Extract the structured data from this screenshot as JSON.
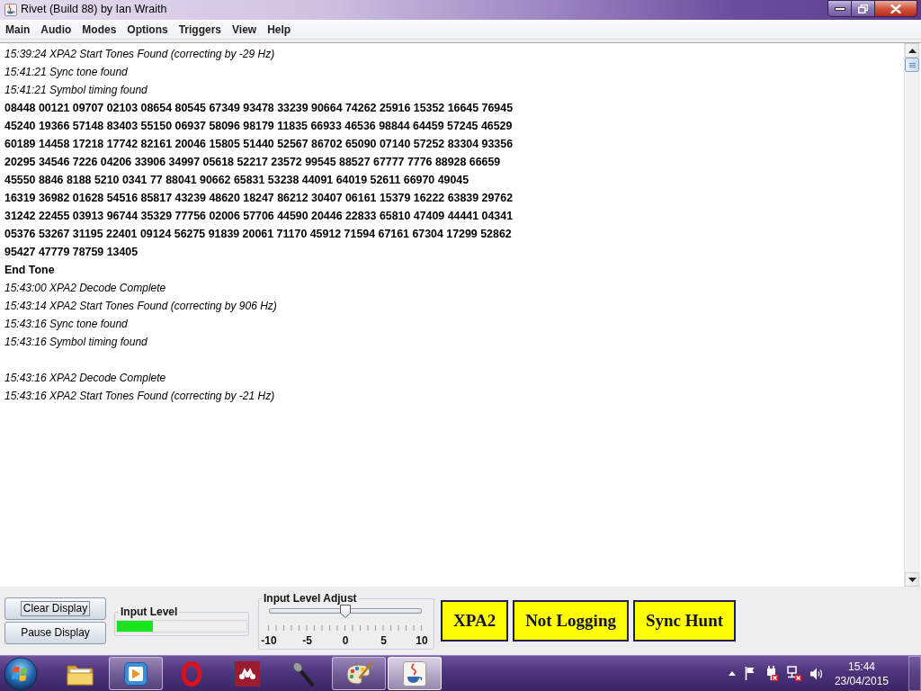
{
  "window": {
    "title": "Rivet (Build 88) by Ian Wraith"
  },
  "menu": [
    "Main",
    "Audio",
    "Modes",
    "Options",
    "Triggers",
    "View",
    "Help"
  ],
  "log": [
    {
      "kind": "status",
      "text": "15:39:24 XPA2 Start Tones Found (correcting by -29 Hz)"
    },
    {
      "kind": "status",
      "text": "15:41:21 Sync tone found"
    },
    {
      "kind": "status",
      "text": "15:41:21 Symbol timing found"
    },
    {
      "kind": "data",
      "text": "08448 00121 09707 02103 08654 80545 67349 93478 33239 90664 74262 25916 15352 16645 76945"
    },
    {
      "kind": "data",
      "text": "45240 19366 57148 83403 55150 06937 58096 98179 11835 66933 46536 98844 64459 57245 46529"
    },
    {
      "kind": "data",
      "text": "60189 14458 17218 17742 82161 20046 15805 51440 52567 86702 65090 07140 57252 83304 93356"
    },
    {
      "kind": "data",
      "text": "20295 34546 7226 04206 33906 34997 05618 52217 23572 99545 88527 67777 7776 88928 66659"
    },
    {
      "kind": "data",
      "text": "45550 8846 8188 5210 0341 77 88041 90662 65831 53238 44091 64019 52611 66970 49045"
    },
    {
      "kind": "data",
      "text": "16319 36982 01628 54516 85817 43239 48620 18247 86212 30407 06161 15379 16222 63839 29762"
    },
    {
      "kind": "data",
      "text": "31242 22455 03913 96744 35329 77756 02006 57706 44590 20446 22833 65810 47409 44441 04341"
    },
    {
      "kind": "data",
      "text": "05376 53267 31195 22401 09124 56275 91839 20061 71170 45912 71594 67161 67304 17299 52862"
    },
    {
      "kind": "data",
      "text": "95427 47779 78759 13405"
    },
    {
      "kind": "event",
      "text": "End Tone"
    },
    {
      "kind": "status",
      "text": "15:43:00 XPA2 Decode Complete"
    },
    {
      "kind": "status",
      "text": "15:43:14 XPA2 Start Tones Found (correcting by 906 Hz)"
    },
    {
      "kind": "status",
      "text": "15:43:16 Sync tone found"
    },
    {
      "kind": "status",
      "text": "15:43:16 Symbol timing found"
    },
    {
      "kind": "gap"
    },
    {
      "kind": "status",
      "text": "15:43:16 XPA2 Decode Complete"
    },
    {
      "kind": "status",
      "text": "15:43:16 XPA2 Start Tones Found (correcting by -21 Hz)"
    }
  ],
  "controls": {
    "buttons": [
      {
        "label": "Clear Display",
        "focused": true
      },
      {
        "label": "Pause Display",
        "focused": false
      }
    ],
    "input_level": {
      "title": "Input Level",
      "level": 0.28
    },
    "input_level_adjust": {
      "title": "Input Level Adjust",
      "level": 0.5,
      "tick_labels": [
        "-10",
        "-5",
        "0",
        "5",
        "10"
      ]
    },
    "indicators": [
      "XPA2",
      "Not Logging",
      "Sync Hunt"
    ]
  },
  "taskbar": {
    "apps": [
      {
        "running": false,
        "selected": false
      },
      {
        "running": true,
        "selected": false
      },
      {
        "running": false,
        "selected": false
      },
      {
        "running": false,
        "selected": false
      },
      {
        "running": false,
        "selected": false
      },
      {
        "running": true,
        "selected": false
      },
      {
        "running": true,
        "selected": true
      }
    ],
    "clock": {
      "time": "15:44",
      "date": "23/04/2015"
    }
  }
}
